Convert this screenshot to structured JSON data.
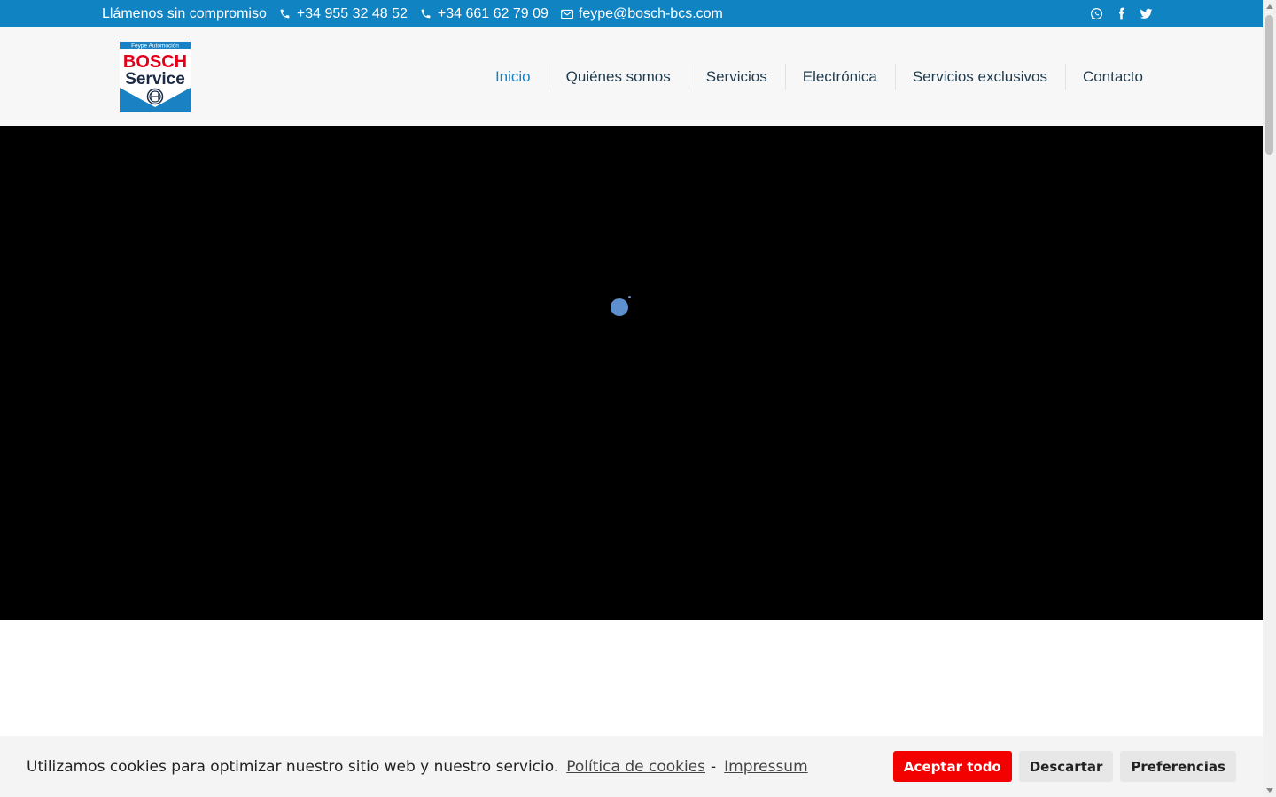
{
  "topbar": {
    "slogan": "Llámenos sin compromiso",
    "phone1": "+34 955 32 48 52",
    "phone2": "+34 661 62 79 09",
    "email": "feype@bosch-bcs.com",
    "icons": [
      "phone-icon",
      "phone-icon",
      "mail-icon",
      "whatsapp-icon",
      "facebook-icon",
      "twitter-icon"
    ],
    "background_color": "#1083c3"
  },
  "logo": {
    "top_text": "Feype Automoción",
    "brand": "BOSCH",
    "sub": "Service"
  },
  "nav": {
    "items": [
      {
        "label": "Inicio",
        "active": true
      },
      {
        "label": "Quiénes somos",
        "active": false
      },
      {
        "label": "Servicios",
        "active": false
      },
      {
        "label": "Electrónica",
        "active": false
      },
      {
        "label": "Servicios exclusivos",
        "active": false
      },
      {
        "label": "Contacto",
        "active": false
      }
    ],
    "active_color": "#1a82c2"
  },
  "cookie": {
    "text": "Utilizamos cookies para optimizar nuestro sitio web y nuestro servicio.",
    "policy_link": "Política de cookies",
    "separator": "-",
    "impressum_link": "Impressum",
    "accept_label": "Aceptar todo",
    "dismiss_label": "Descartar",
    "preferences_label": "Preferencias",
    "accept_color": "#f30000"
  }
}
